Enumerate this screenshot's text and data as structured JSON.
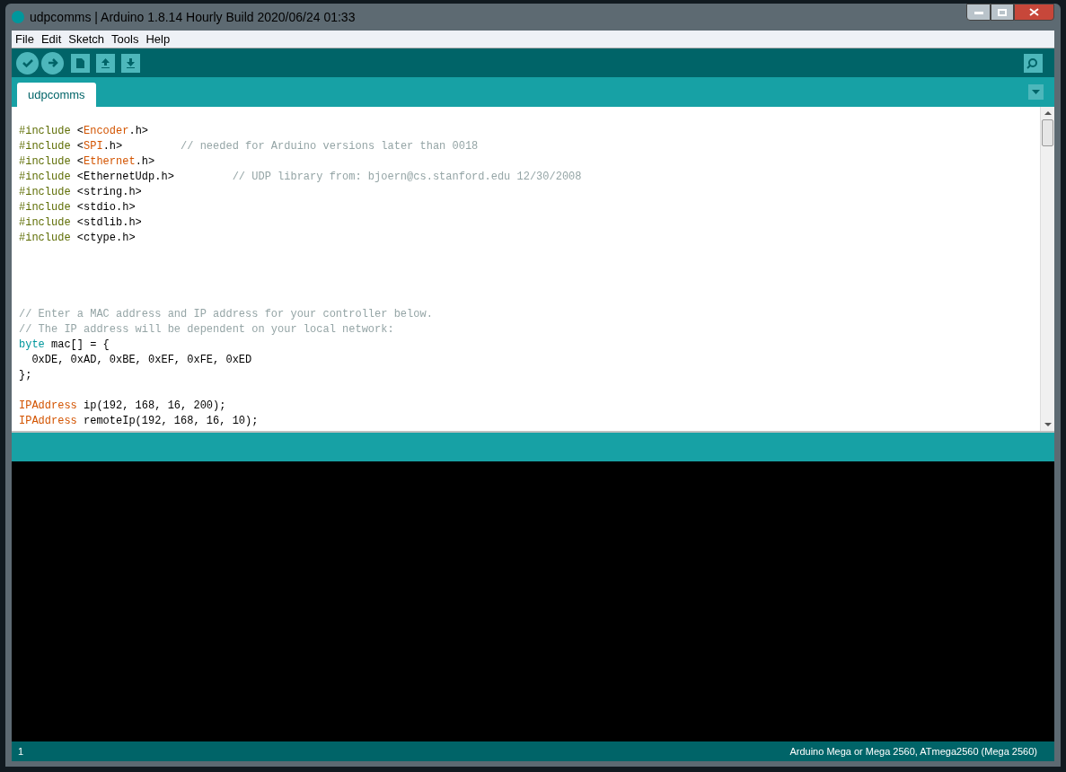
{
  "window": {
    "title": "udpcomms | Arduino 1.8.14 Hourly Build 2020/06/24 01:33"
  },
  "menu": [
    "File",
    "Edit",
    "Sketch",
    "Tools",
    "Help"
  ],
  "toolbar": [
    {
      "kind": "verify"
    },
    {
      "kind": "upload"
    },
    {
      "kind": "new"
    },
    {
      "kind": "open"
    },
    {
      "kind": "save"
    }
  ],
  "tabs": [
    {
      "label": "udpcomms",
      "selected": true
    }
  ],
  "code": [
    {
      "kind": "blank"
    },
    {
      "kind": "code",
      "tokens": [
        {
          "kind": "directive",
          "text": "#include"
        },
        {
          "kind": "plain",
          "text": " <"
        },
        {
          "kind": "library",
          "text": "Encoder"
        },
        {
          "kind": "plain",
          "text": ".h>"
        }
      ]
    },
    {
      "kind": "code",
      "tokens": [
        {
          "kind": "directive",
          "text": "#include"
        },
        {
          "kind": "plain",
          "text": " <"
        },
        {
          "kind": "library",
          "text": "SPI"
        },
        {
          "kind": "plain",
          "text": ".h>         "
        },
        {
          "kind": "comment",
          "text": "// needed for Arduino versions later than 0018"
        }
      ]
    },
    {
      "kind": "code",
      "tokens": [
        {
          "kind": "directive",
          "text": "#include"
        },
        {
          "kind": "plain",
          "text": " <"
        },
        {
          "kind": "library",
          "text": "Ethernet"
        },
        {
          "kind": "plain",
          "text": ".h>"
        }
      ]
    },
    {
      "kind": "code",
      "tokens": [
        {
          "kind": "directive",
          "text": "#include"
        },
        {
          "kind": "plain",
          "text": " <EthernetUdp.h>         "
        },
        {
          "kind": "comment",
          "text": "// UDP library from: bjoern@cs.stanford.edu 12/30/2008"
        }
      ]
    },
    {
      "kind": "code",
      "tokens": [
        {
          "kind": "directive",
          "text": "#include"
        },
        {
          "kind": "plain",
          "text": " <string.h>"
        }
      ]
    },
    {
      "kind": "code",
      "tokens": [
        {
          "kind": "directive",
          "text": "#include"
        },
        {
          "kind": "plain",
          "text": " <stdio.h>"
        }
      ]
    },
    {
      "kind": "code",
      "tokens": [
        {
          "kind": "directive",
          "text": "#include"
        },
        {
          "kind": "plain",
          "text": " <stdlib.h>"
        }
      ]
    },
    {
      "kind": "code",
      "tokens": [
        {
          "kind": "directive",
          "text": "#include"
        },
        {
          "kind": "plain",
          "text": " <ctype.h>"
        }
      ]
    },
    {
      "kind": "blank"
    },
    {
      "kind": "blank"
    },
    {
      "kind": "blank"
    },
    {
      "kind": "blank"
    },
    {
      "kind": "code",
      "tokens": [
        {
          "kind": "comment",
          "text": "// Enter a MAC address and IP address for your controller below."
        }
      ]
    },
    {
      "kind": "code",
      "tokens": [
        {
          "kind": "comment",
          "text": "// The IP address will be dependent on your local network:"
        }
      ]
    },
    {
      "kind": "code",
      "tokens": [
        {
          "kind": "type",
          "text": "byte"
        },
        {
          "kind": "plain",
          "text": " mac[] = {"
        }
      ]
    },
    {
      "kind": "code",
      "tokens": [
        {
          "kind": "plain",
          "text": "  0xDE, 0xAD, 0xBE, 0xEF, 0xFE, 0xED"
        }
      ]
    },
    {
      "kind": "code",
      "tokens": [
        {
          "kind": "plain",
          "text": "};"
        }
      ]
    },
    {
      "kind": "blank"
    },
    {
      "kind": "code",
      "tokens": [
        {
          "kind": "library",
          "text": "IPAddress"
        },
        {
          "kind": "plain",
          "text": " ip(192, 168, 16, 200);"
        }
      ]
    },
    {
      "kind": "code",
      "tokens": [
        {
          "kind": "library",
          "text": "IPAddress"
        },
        {
          "kind": "plain",
          "text": " remoteIp(192, 168, 16, 10);"
        }
      ]
    }
  ],
  "status_bar": {
    "line": "1",
    "board": "Arduino Mega or Mega 2560, ATmega2560 (Mega 2560)"
  }
}
